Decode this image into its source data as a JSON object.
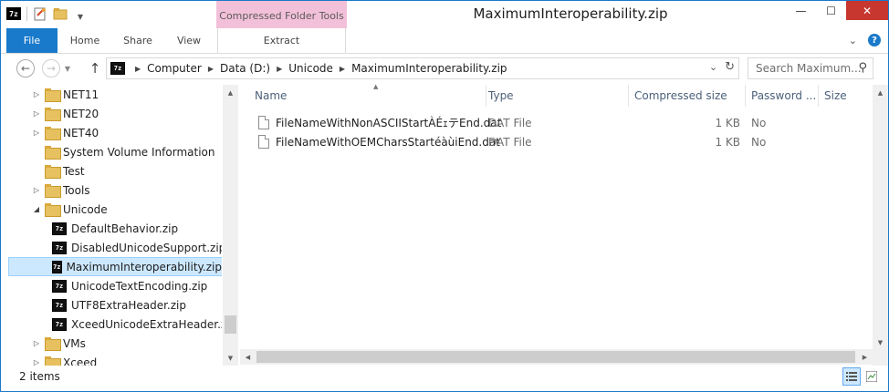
{
  "window": {
    "title": "MaximumInteroperability.zip",
    "contextual_tab_group": "Compressed Folder Tools",
    "controls": {
      "minimize": "—",
      "maximize": "☐",
      "close": "✕"
    },
    "app_badge": "7z"
  },
  "ribbon": {
    "tabs": [
      {
        "label": "File"
      },
      {
        "label": "Home"
      },
      {
        "label": "Share"
      },
      {
        "label": "View"
      },
      {
        "label": "Extract"
      }
    ],
    "help_glyph": "?",
    "collapse_glyph": "⌄"
  },
  "address": {
    "crumbs": [
      "Computer",
      "Data (D:)",
      "Unicode",
      "MaximumInteroperability.zip"
    ],
    "search_placeholder": "Search Maximum...",
    "dropdown_glyph": "⌄",
    "refresh_glyph": "↻"
  },
  "nav_tree": [
    {
      "label": "NET11",
      "expander": "▷",
      "icon": "folder-icon"
    },
    {
      "label": "NET20",
      "expander": "▷",
      "icon": "folder-icon"
    },
    {
      "label": "NET40",
      "expander": "▷",
      "icon": "folder-icon"
    },
    {
      "label": "System Volume Information",
      "expander": "",
      "icon": "folder-icon"
    },
    {
      "label": "Test",
      "expander": "",
      "icon": "folder-icon"
    },
    {
      "label": "Tools",
      "expander": "▷",
      "icon": "folder-icon"
    },
    {
      "label": "Unicode",
      "expander": "◢",
      "icon": "folder-icon"
    },
    {
      "label": "DefaultBehavior.zip",
      "expander": "",
      "icon": "zip-icon"
    },
    {
      "label": "DisabledUnicodeSupport.zip",
      "expander": "",
      "icon": "zip-icon"
    },
    {
      "label": "MaximumInteroperability.zip",
      "expander": "",
      "icon": "zip-icon",
      "selected": true
    },
    {
      "label": "UnicodeTextEncoding.zip",
      "expander": "",
      "icon": "zip-icon"
    },
    {
      "label": "UTF8ExtraHeader.zip",
      "expander": "",
      "icon": "zip-icon"
    },
    {
      "label": "XceedUnicodeExtraHeader.zip",
      "expander": "",
      "icon": "zip-icon"
    },
    {
      "label": "VMs",
      "expander": "▷",
      "icon": "folder-icon"
    },
    {
      "label": "Xceed",
      "expander": "▷",
      "icon": "folder-icon"
    }
  ],
  "file_list": {
    "columns": [
      "Name",
      "Type",
      "Compressed size",
      "Password ...",
      "Size"
    ],
    "rows": [
      {
        "name": "FileNameWithNonASCIIStartÀÉｪテEnd.dat",
        "type": "DAT File",
        "compressed_size": "1 KB",
        "password": "No"
      },
      {
        "name": "FileNameWithOEMCharsStartéàùiEnd.dat",
        "type": "DAT File",
        "compressed_size": "1 KB",
        "password": "No"
      }
    ]
  },
  "status": {
    "item_count": "2 items"
  },
  "colors": {
    "accent": "#1979ca",
    "contextual_tab": "#f3c0d9",
    "selection": "#cce8ff",
    "close_button": "#c7372f"
  }
}
